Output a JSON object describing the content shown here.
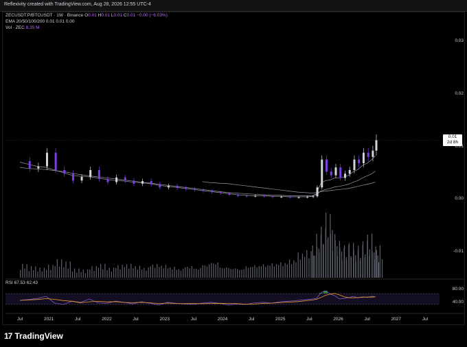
{
  "header": {
    "title": "Reflexivity created with TradingView.com, Aug 28, 2026 12:55 UTC-4"
  },
  "legend": {
    "symbol": "ZECUSDT.P/BTCUSDT · 1W · Binance",
    "o_key": "O",
    "o_val": "0.01",
    "h_key": "H",
    "h_val": "0.01",
    "l_key": "L",
    "l_val": "0.01",
    "c_key": "C",
    "c_val": "0.01 −0.00 (−6.03%)",
    "ema_label": "EMA 20/50/100/200",
    "ema_vals": "0.01  0.01  0.00",
    "vol_label": "Vol · ZEC",
    "vol_val": "8.35 M"
  },
  "rsi": {
    "label": "RSI",
    "value1": "67.53",
    "value2": "62.43",
    "upper": "80.00",
    "lower": "40.00"
  },
  "price_tag": {
    "value": "0.01",
    "countdown": "2d 8h"
  },
  "brand": {
    "name": "TradingView",
    "mark": "17"
  },
  "colors": {
    "up": "#d1d4dc",
    "down": "#7b3fe4",
    "rsi_line": "#7e57c2",
    "rsi_ma": "#f0a030",
    "volume": "#5d606b"
  },
  "chart_data": {
    "type": "line",
    "y_axis": {
      "ticks": [
        "0.03",
        "0.02",
        "0.01",
        "0.00",
        "-0.01"
      ]
    },
    "x_axis": {
      "ticks": [
        "Jul",
        "2021",
        "Jul",
        "2022",
        "Jul",
        "2023",
        "Jul",
        "2024",
        "Jul",
        "2025",
        "Jul",
        "2026",
        "Jul",
        "2027",
        "Jul"
      ]
    },
    "x": [
      2020.5,
      2020.65,
      2020.8,
      2020.95,
      2021.1,
      2021.25,
      2021.4,
      2021.55,
      2021.7,
      2021.85,
      2022.0,
      2022.15,
      2022.3,
      2022.45,
      2022.6,
      2022.75,
      2022.9,
      2023.05,
      2023.2,
      2023.35,
      2023.5,
      2023.65,
      2023.8,
      2023.95,
      2024.1,
      2024.25,
      2024.4,
      2024.55,
      2024.7,
      2024.85,
      2025.0,
      2025.15,
      2025.3,
      2025.45,
      2025.55,
      2025.62,
      2025.7,
      2025.78,
      2025.86,
      2025.94,
      2026.02,
      2026.1,
      2026.18,
      2026.26,
      2026.34,
      2026.42,
      2026.5,
      2026.58,
      2026.64
    ],
    "series": [
      {
        "name": "",
        "values": [
          0.0072,
          0.0058,
          0.0062,
          0.0088,
          0.0055,
          0.0048,
          0.0035,
          0.0042,
          0.0055,
          0.0038,
          0.0032,
          0.0041,
          0.0035,
          0.0029,
          0.0034,
          0.0028,
          0.0022,
          0.0025,
          0.0021,
          0.0019,
          0.0017,
          0.0015,
          0.0013,
          0.0011,
          0.0008,
          0.0006,
          0.0005,
          0.0006,
          0.0005,
          0.0004,
          0.0004,
          0.0003,
          0.0003,
          0.0004,
          0.0005,
          0.0022,
          0.0075,
          0.0052,
          0.0045,
          0.006,
          0.004,
          0.0048,
          0.0055,
          0.0075,
          0.0068,
          0.0088,
          0.008,
          0.0092,
          0.0112
        ]
      }
    ],
    "ema": [
      {
        "values": [
          0.007,
          0.0066,
          0.0062,
          0.006,
          0.0055,
          0.005,
          0.0045,
          0.0043,
          0.0042,
          0.004,
          0.0037,
          0.0035,
          0.0034,
          0.0032,
          0.0031,
          0.0029,
          0.0026,
          0.0024,
          0.0022,
          0.002,
          0.0018,
          0.0016,
          0.0014,
          0.0012,
          0.001,
          0.0008,
          0.0007,
          0.0006,
          0.0006,
          0.0005,
          0.0005,
          0.0004,
          0.0004,
          0.0004,
          0.0005,
          0.001,
          0.003,
          0.0035,
          0.0036,
          0.004,
          0.004,
          0.0042,
          0.0045,
          0.0052,
          0.0056,
          0.0064,
          0.0068,
          0.0075,
          0.0082
        ]
      },
      {
        "values": [
          0.006,
          0.0058,
          0.0057,
          0.0056,
          0.0054,
          0.0052,
          0.0049,
          0.0046,
          0.0044,
          0.0042,
          0.004,
          0.0038,
          0.0036,
          0.0034,
          0.0032,
          0.003,
          0.0028,
          0.0026,
          0.0024,
          0.0022,
          0.002,
          0.0018,
          0.0016,
          0.0014,
          0.0012,
          0.0011,
          0.001,
          0.0009,
          0.0008,
          0.0007,
          0.0007,
          0.0006,
          0.0006,
          0.0006,
          0.0006,
          0.0008,
          0.0015,
          0.0018,
          0.002,
          0.0023,
          0.0024,
          0.0026,
          0.0028,
          0.0032,
          0.0035,
          0.004,
          0.0044,
          0.0048,
          0.0053
        ]
      },
      {
        "values": [
          null,
          null,
          null,
          null,
          null,
          null,
          null,
          null,
          null,
          null,
          null,
          null,
          null,
          null,
          null,
          null,
          null,
          null,
          null,
          null,
          null,
          0.0033,
          0.0031,
          0.003,
          0.0029,
          0.0027,
          0.0025,
          0.0023,
          0.0021,
          0.0019,
          0.0017,
          0.0015,
          0.0013,
          0.0012,
          0.0011,
          0.0012,
          0.0014,
          0.0015,
          0.0016,
          0.0017,
          0.0018,
          0.0019,
          0.002,
          0.0022,
          0.0024,
          0.0026,
          0.0028,
          0.003,
          0.0032
        ]
      }
    ],
    "volume": [
      30,
      25,
      22,
      28,
      40,
      35,
      20,
      18,
      25,
      30,
      22,
      28,
      30,
      26,
      22,
      30,
      28,
      24,
      20,
      26,
      22,
      30,
      35,
      24,
      22,
      20,
      26,
      28,
      30,
      32,
      34,
      40,
      55,
      60,
      70,
      95,
      110,
      140,
      95,
      80,
      65,
      70,
      75,
      60,
      70,
      80,
      95,
      60,
      70
    ],
    "rsi": [
      55,
      58,
      62,
      70,
      45,
      40,
      52,
      48,
      60,
      46,
      44,
      52,
      48,
      42,
      50,
      44,
      38,
      48,
      44,
      42,
      40,
      45,
      48,
      44,
      38,
      42,
      40,
      46,
      48,
      45,
      50,
      52,
      55,
      58,
      60,
      62,
      82,
      90,
      78,
      72,
      60,
      62,
      65,
      70,
      64,
      68,
      66,
      70,
      68
    ],
    "ylim": [
      -0.015,
      0.035
    ]
  }
}
